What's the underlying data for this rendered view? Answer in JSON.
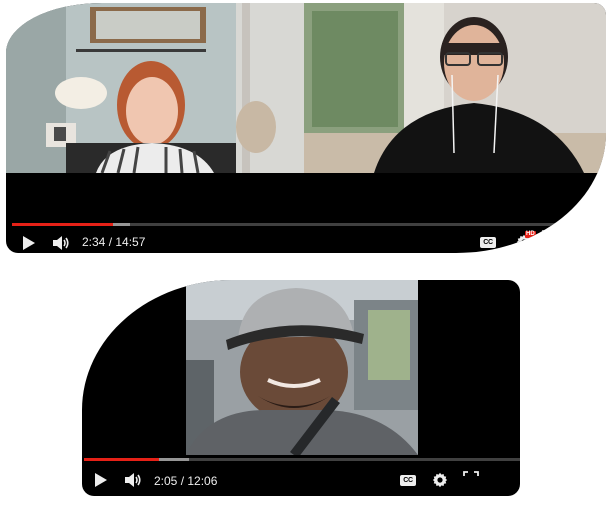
{
  "players": [
    {
      "time_display": "2:34 / 14:57",
      "progress_fraction": 0.172,
      "buffered_fraction": 0.2,
      "captions_label": "CC",
      "hd_badge": "HD",
      "participants": [
        "woman-in-striped-shirt",
        "man-in-black-shirt-with-glasses"
      ]
    },
    {
      "time_display": "2:05 / 12:06",
      "progress_fraction": 0.172,
      "buffered_fraction": 0.24,
      "captions_label": "CC",
      "participants": [
        "man-in-cap-in-car"
      ]
    }
  ],
  "colors": {
    "progress_played": "#e62117",
    "player_background": "#000000",
    "controls_foreground": "#eeeeee"
  },
  "icons": [
    "play-icon",
    "volume-icon",
    "captions-icon",
    "settings-icon",
    "fullscreen-icon"
  ]
}
